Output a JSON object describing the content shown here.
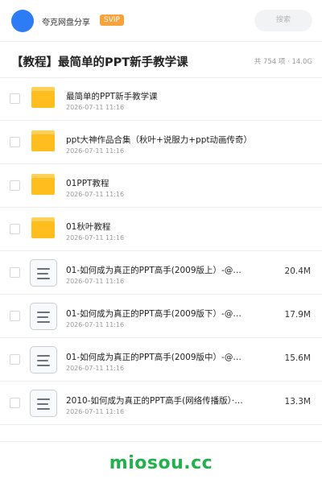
{
  "header": {
    "share_name": "夸克网盘分享",
    "badge": "SVIP",
    "search_placeholder": "搜索"
  },
  "folder": {
    "title": "【教程】最简单的PPT新手教学课",
    "meta": "共 754 项 · 14.0G"
  },
  "files": [
    {
      "type": "folder",
      "name": "最简单的PPT新手教学课",
      "date": "2026-07-11 11:16",
      "size": ""
    },
    {
      "type": "folder",
      "name": "ppt大神作品合集（秋叶+说服力+ppt动画传奇）",
      "date": "2026-07-11 11:16",
      "size": ""
    },
    {
      "type": "folder",
      "name": "01PPT教程",
      "date": "2026-07-11 11:16",
      "size": ""
    },
    {
      "type": "folder",
      "name": "01秋叶教程",
      "date": "2026-07-11 11:16",
      "size": ""
    },
    {
      "type": "file",
      "name": "01-如何成为真正的PPT高手(2009版上）-@…",
      "date": "2026-07-11 11:16",
      "size": "20.4M"
    },
    {
      "type": "file",
      "name": "01-如何成为真正的PPT高手(2009版下）-@…",
      "date": "2026-07-11 11:16",
      "size": "17.9M"
    },
    {
      "type": "file",
      "name": "01-如何成为真正的PPT高手(2009版中）-@…",
      "date": "2026-07-11 11:16",
      "size": "15.6M"
    },
    {
      "type": "file",
      "name": "2010-如何成为真正的PPT高手(网络传播版）·…",
      "date": "2026-07-11 11:16",
      "size": "13.3M"
    }
  ],
  "watermark": "miosou.cc",
  "colors": {
    "avatar": "#2d7cf6",
    "badge": "#f7a23b",
    "folder": "#ffbe1e",
    "watermark": "#22b14c"
  }
}
